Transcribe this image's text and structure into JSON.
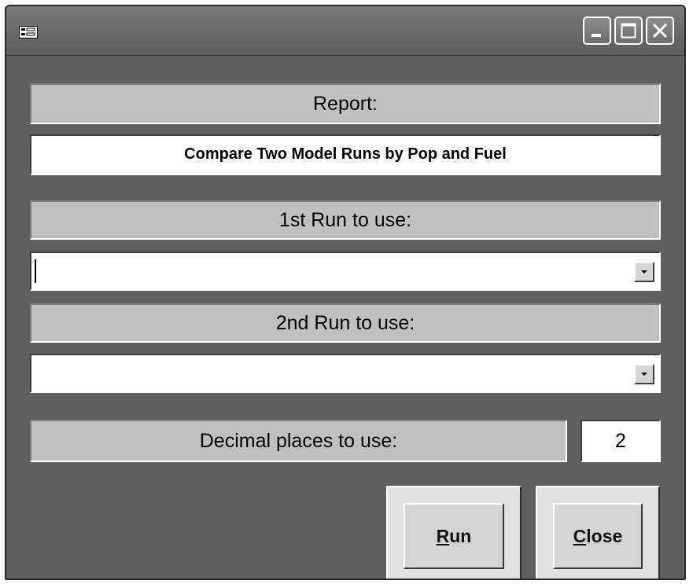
{
  "window": {
    "icon": "form-icon",
    "controls": [
      "minimize-icon",
      "maximize-icon",
      "close-icon"
    ]
  },
  "report": {
    "label": "Report:",
    "value": "Compare Two Model Runs by Pop and Fuel"
  },
  "run1": {
    "label": "1st Run to use:",
    "selected": ""
  },
  "run2": {
    "label": "2nd Run to use:",
    "selected": ""
  },
  "decimals": {
    "label": "Decimal places to use:",
    "value": "2"
  },
  "buttons": {
    "run": {
      "mnemonic": "R",
      "rest": "un"
    },
    "close": {
      "mnemonic": "C",
      "rest": "lose"
    }
  }
}
